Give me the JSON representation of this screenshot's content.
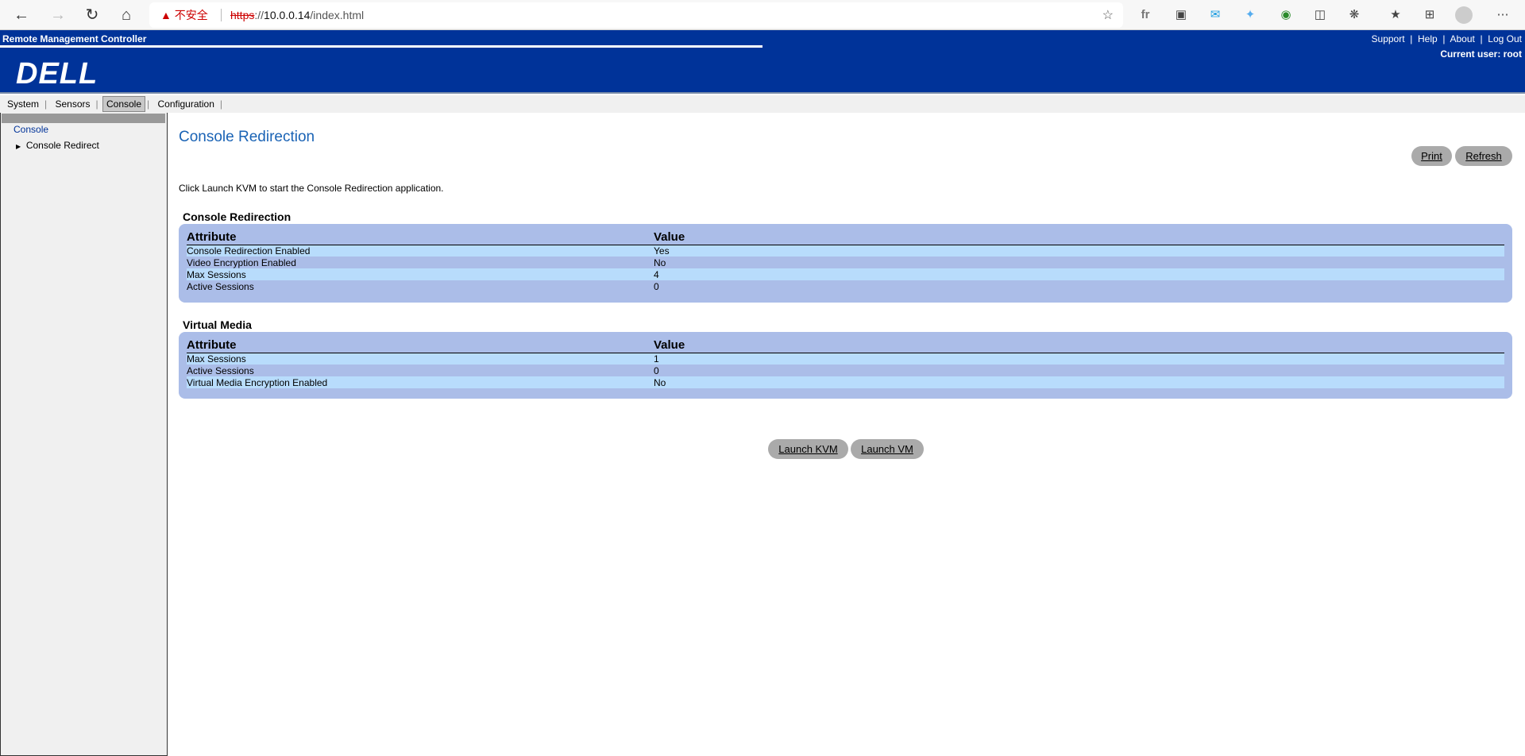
{
  "browser": {
    "security_label": "不安全",
    "url_scheme": "https",
    "url_host": "10.0.0.14",
    "url_path": "/index.html",
    "extensions": [
      "fr",
      "tampermonkey",
      "mail",
      "twitter",
      "globe",
      "bitwarden",
      "extensions",
      "favorites",
      "collections",
      "profile",
      "more"
    ]
  },
  "header": {
    "product": "Remote Management Controller",
    "logo": "DELL",
    "links": [
      "Support",
      "Help",
      "About",
      "Log Out"
    ],
    "current_user": "Current user: root"
  },
  "tabs": [
    {
      "label": "System"
    },
    {
      "label": "Sensors"
    },
    {
      "label": "Console",
      "active": true
    },
    {
      "label": "Configuration"
    }
  ],
  "sidebar": {
    "section": "Console",
    "items": [
      {
        "label": "Console Redirect"
      }
    ]
  },
  "main": {
    "title": "Console Redirection",
    "print": "Print",
    "refresh": "Refresh",
    "intro": "Click Launch KVM to start the Console Redirection application.",
    "console": {
      "heading": "Console Redirection",
      "col_attr": "Attribute",
      "col_value": "Value",
      "rows": [
        [
          "Console Redirection Enabled",
          "Yes"
        ],
        [
          "Video Encryption Enabled",
          "No"
        ],
        [
          "Max Sessions",
          "4"
        ],
        [
          "Active Sessions",
          "0"
        ]
      ]
    },
    "vm": {
      "heading": "Virtual Media",
      "col_attr": "Attribute",
      "col_value": "Value",
      "rows": [
        [
          "Max Sessions",
          "1"
        ],
        [
          "Active Sessions",
          "0"
        ],
        [
          "Virtual Media Encryption Enabled",
          "No"
        ]
      ]
    },
    "launch_kvm": "Launch KVM",
    "launch_vm": "Launch VM"
  },
  "colors": {
    "banner": "#003399",
    "table_bg": "#abbde8",
    "row_alt": "#b8dcfc",
    "title": "#1a63b5",
    "button": "#aaaaaa"
  }
}
